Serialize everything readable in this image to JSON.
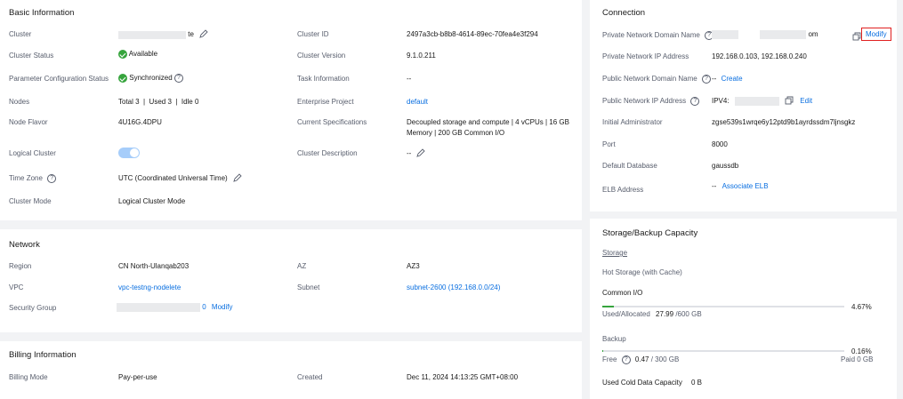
{
  "basic": {
    "title": "Basic Information",
    "cluster_label": "Cluster",
    "cluster_value_suffix": "te",
    "cluster_status_label": "Cluster Status",
    "cluster_status_value": "Available",
    "param_label": "Parameter Configuration Status",
    "param_value": "Synchronized",
    "nodes_label": "Nodes",
    "nodes_value": "Total 3  |  Used 3  |  Idle 0",
    "flavor_label": "Node Flavor",
    "flavor_value": "4U16G.4DPU",
    "logical_label": "Logical Cluster",
    "timezone_label": "Time Zone",
    "timezone_value": "UTC (Coordinated Universal Time)",
    "mode_label": "Cluster Mode",
    "mode_value": "Logical Cluster Mode",
    "id_label": "Cluster ID",
    "id_value": "2497a3cb-b8b8-4614-89ec-70fea4e3f294",
    "version_label": "Cluster Version",
    "version_value": "9.1.0.211",
    "task_label": "Task Information",
    "task_value": "--",
    "project_label": "Enterprise Project",
    "project_value": "default",
    "spec_label": "Current Specifications",
    "spec_line1": "Decoupled storage and compute | 4 vCPUs | 16 GB",
    "spec_line2": "Memory | 200 GB Common I/O",
    "desc_label": "Cluster Description",
    "desc_value": "--"
  },
  "network": {
    "title": "Network",
    "region_label": "Region",
    "region_value": "CN North-Ulanqab203",
    "vpc_label": "VPC",
    "vpc_value": "vpc-testng-nodelete",
    "sg_label": "Security Group",
    "sg_suffix": "0",
    "sg_modify": "Modify",
    "az_label": "AZ",
    "az_value": "AZ3",
    "subnet_label": "Subnet",
    "subnet_value": "subnet-2600 (192.168.0.0/24)"
  },
  "billing": {
    "title": "Billing Information",
    "mode_label": "Billing Mode",
    "mode_value": "Pay-per-use",
    "created_label": "Created",
    "created_value": "Dec 11, 2024 14:13:25 GMT+08:00"
  },
  "connection": {
    "title": "Connection",
    "pndn_label": "Private Network Domain Name",
    "pndn_suffix": "om",
    "modify": "Modify",
    "pnip_label": "Private Network IP Address",
    "pnip_value": "192.168.0.103, 192.168.0.240",
    "pubdn_label": "Public Network Domain Name",
    "pubdn_dash": "--",
    "pubdn_create": "Create",
    "pubip_label": "Public Network IP Address",
    "pubip_prefix": "IPV4:",
    "pubip_edit": "Edit",
    "admin_label": "Initial Administrator",
    "admin_value": "zgse539s1wrqe6y12ptd9b1ayrdssdm7ljnsgkz",
    "port_label": "Port",
    "port_value": "8000",
    "db_label": "Default Database",
    "db_value": "gaussdb",
    "elb_label": "ELB Address",
    "elb_dash": "--",
    "elb_link": "Associate ELB"
  },
  "storage": {
    "title": "Storage/Backup Capacity",
    "tab": "Storage",
    "hot_label": "Hot Storage (with Cache)",
    "common_label": "Common I/O",
    "common_pct": "4.67%",
    "common_fill": 4.67,
    "used_label": "Used/Allocated",
    "used_value": "27.99",
    "used_total": "/600 GB",
    "backup_label": "Backup",
    "backup_pct": "0.16%",
    "backup_fill": 0.16,
    "free_label": "Free",
    "free_value": "0.47",
    "free_total": "/ 300 GB",
    "paid_label": "Paid 0 GB",
    "cold_label": "Used Cold Data Capacity",
    "cold_value": "0 B"
  },
  "colors": {
    "link": "#0a6fe0",
    "success": "#36a43d",
    "highlight": "#e02020"
  }
}
